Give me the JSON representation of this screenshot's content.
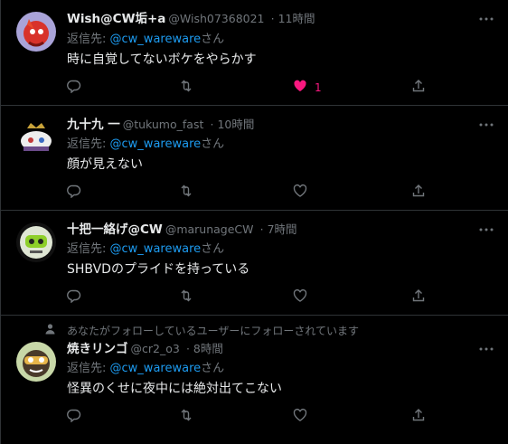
{
  "colors": {
    "accent": "#1d9bf0",
    "like": "#f91880",
    "muted": "#71767b"
  },
  "reply_prefix": "返信先:",
  "reply_suffix": "さん",
  "tweets": [
    {
      "name": "Wish@CW垢+a",
      "handle": "@Wish07368021",
      "time": "· 11時間",
      "mention": "@cw_wareware",
      "text": "時に自覚してないボケをやらかす",
      "likes": "1",
      "liked": true,
      "avatar_icon": "avatar-red-character"
    },
    {
      "name": "九十九 一",
      "handle": "@tukumo_fast",
      "time": "· 10時間",
      "mention": "@cw_wareware",
      "text": "顔が見えない",
      "likes": "",
      "liked": false,
      "avatar_icon": "avatar-crowned-character"
    },
    {
      "name": "十把一絡げ@CW",
      "handle": "@marunageCW",
      "time": "· 7時間",
      "mention": "@cw_wareware",
      "text": "SHBVDのプライドを持っている",
      "likes": "",
      "liked": false,
      "avatar_icon": "avatar-green-robot"
    },
    {
      "social_context": "あなたがフォローしているユーザーにフォローされています",
      "name": "焼きリンゴ",
      "handle": "@cr2_o3",
      "time": "· 8時間",
      "mention": "@cw_wareware",
      "text": "怪異のくせに夜中には絶対出てこない",
      "likes": "",
      "liked": false,
      "avatar_icon": "avatar-goggles-character"
    }
  ]
}
